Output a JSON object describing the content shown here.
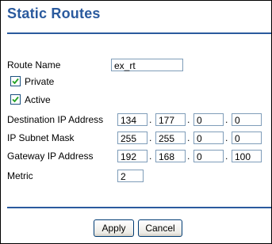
{
  "page": {
    "title": "Static Routes"
  },
  "form": {
    "route_name": {
      "label": "Route Name",
      "value": "ex_rt"
    },
    "private": {
      "label": "Private",
      "checked": true
    },
    "active": {
      "label": "Active",
      "checked": true
    },
    "destination_ip": {
      "label": "Destination IP Address",
      "octets": [
        "134",
        "177",
        "0",
        "0"
      ]
    },
    "subnet_mask": {
      "label": "IP Subnet Mask",
      "octets": [
        "255",
        "255",
        "0",
        "0"
      ]
    },
    "gateway_ip": {
      "label": "Gateway IP Address",
      "octets": [
        "192",
        "168",
        "0",
        "100"
      ]
    },
    "metric": {
      "label": "Metric",
      "value": "2"
    },
    "separator": "."
  },
  "buttons": {
    "apply": "Apply",
    "cancel": "Cancel"
  },
  "colors": {
    "title": "#2a5a9e",
    "input_border": "#7f9db9",
    "checkbox_border": "#1c5180",
    "checkmark": "#21a121"
  }
}
